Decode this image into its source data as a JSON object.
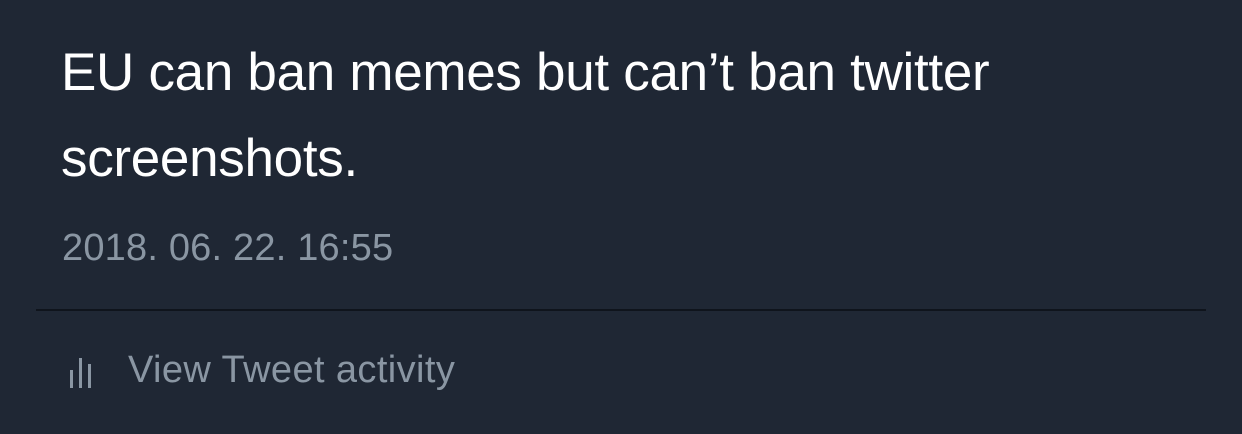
{
  "tweet": {
    "text": "EU can ban memes but can’t ban twitter screenshots.",
    "timestamp": "2018. 06. 22. 16:55"
  },
  "actions": {
    "activity_label": "View Tweet activity",
    "activity_icon": "bar-chart-icon"
  },
  "colors": {
    "background": "#1f2734",
    "text_primary": "#ffffff",
    "text_secondary": "#8a96a3",
    "divider": "#0f141c"
  }
}
